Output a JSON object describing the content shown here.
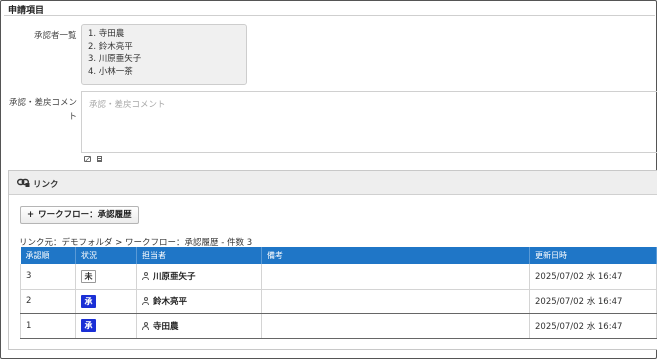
{
  "section": {
    "title": "申請項目"
  },
  "approvers": {
    "label": "承認者一覧",
    "items": [
      "1. 寺田農",
      "2. 鈴木亮平",
      "3. 川原亜矢子",
      "4. 小林一茶"
    ]
  },
  "comment": {
    "label_line1": "承認・差戻コメント",
    "placeholder": "承認・差戻コメント"
  },
  "link": {
    "title": "リンク",
    "add_button_label": "ワークフロー：承認履歴",
    "breadcrumb": "リンク元：デモフォルダ > ワークフロー：承認履歴 - 件数 3"
  },
  "table": {
    "headers": [
      "承認順",
      "状況",
      "担当者",
      "備考",
      "更新日時"
    ],
    "rows": [
      {
        "order": "3",
        "status": "未",
        "assignee": "川原亜矢子",
        "note": "",
        "updated": "2025/07/02 水 16:47"
      },
      {
        "order": "2",
        "status": "承",
        "assignee": "鈴木亮平",
        "note": "",
        "updated": "2025/07/02 水 16:47"
      },
      {
        "order": "1",
        "status": "承",
        "assignee": "寺田農",
        "note": "",
        "updated": "2025/07/02 水 16:47"
      }
    ]
  },
  "colors": {
    "header_blue": "#1f76c7",
    "approved_badge": "#1a2fd6"
  }
}
